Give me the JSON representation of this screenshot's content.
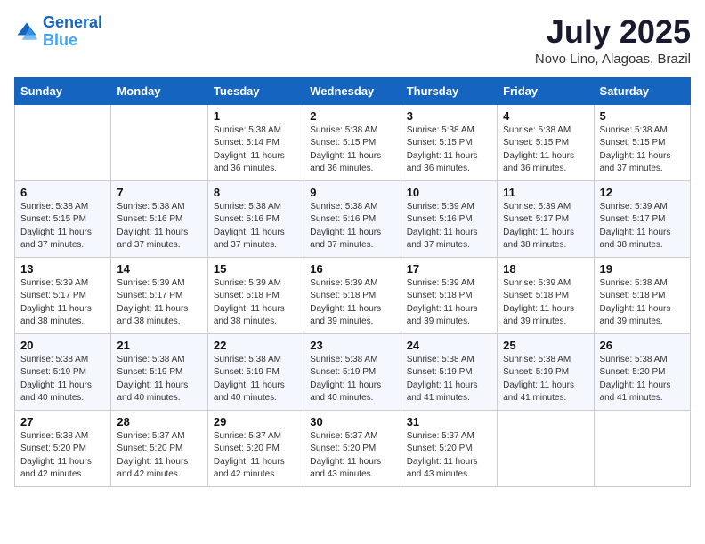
{
  "header": {
    "logo_line1": "General",
    "logo_line2": "Blue",
    "month_year": "July 2025",
    "location": "Novo Lino, Alagoas, Brazil"
  },
  "weekdays": [
    "Sunday",
    "Monday",
    "Tuesday",
    "Wednesday",
    "Thursday",
    "Friday",
    "Saturday"
  ],
  "weeks": [
    [
      {
        "day": "",
        "sunrise": "",
        "sunset": "",
        "daylight": ""
      },
      {
        "day": "",
        "sunrise": "",
        "sunset": "",
        "daylight": ""
      },
      {
        "day": "1",
        "sunrise": "Sunrise: 5:38 AM",
        "sunset": "Sunset: 5:14 PM",
        "daylight": "Daylight: 11 hours and 36 minutes."
      },
      {
        "day": "2",
        "sunrise": "Sunrise: 5:38 AM",
        "sunset": "Sunset: 5:15 PM",
        "daylight": "Daylight: 11 hours and 36 minutes."
      },
      {
        "day": "3",
        "sunrise": "Sunrise: 5:38 AM",
        "sunset": "Sunset: 5:15 PM",
        "daylight": "Daylight: 11 hours and 36 minutes."
      },
      {
        "day": "4",
        "sunrise": "Sunrise: 5:38 AM",
        "sunset": "Sunset: 5:15 PM",
        "daylight": "Daylight: 11 hours and 36 minutes."
      },
      {
        "day": "5",
        "sunrise": "Sunrise: 5:38 AM",
        "sunset": "Sunset: 5:15 PM",
        "daylight": "Daylight: 11 hours and 37 minutes."
      }
    ],
    [
      {
        "day": "6",
        "sunrise": "Sunrise: 5:38 AM",
        "sunset": "Sunset: 5:15 PM",
        "daylight": "Daylight: 11 hours and 37 minutes."
      },
      {
        "day": "7",
        "sunrise": "Sunrise: 5:38 AM",
        "sunset": "Sunset: 5:16 PM",
        "daylight": "Daylight: 11 hours and 37 minutes."
      },
      {
        "day": "8",
        "sunrise": "Sunrise: 5:38 AM",
        "sunset": "Sunset: 5:16 PM",
        "daylight": "Daylight: 11 hours and 37 minutes."
      },
      {
        "day": "9",
        "sunrise": "Sunrise: 5:38 AM",
        "sunset": "Sunset: 5:16 PM",
        "daylight": "Daylight: 11 hours and 37 minutes."
      },
      {
        "day": "10",
        "sunrise": "Sunrise: 5:39 AM",
        "sunset": "Sunset: 5:16 PM",
        "daylight": "Daylight: 11 hours and 37 minutes."
      },
      {
        "day": "11",
        "sunrise": "Sunrise: 5:39 AM",
        "sunset": "Sunset: 5:17 PM",
        "daylight": "Daylight: 11 hours and 38 minutes."
      },
      {
        "day": "12",
        "sunrise": "Sunrise: 5:39 AM",
        "sunset": "Sunset: 5:17 PM",
        "daylight": "Daylight: 11 hours and 38 minutes."
      }
    ],
    [
      {
        "day": "13",
        "sunrise": "Sunrise: 5:39 AM",
        "sunset": "Sunset: 5:17 PM",
        "daylight": "Daylight: 11 hours and 38 minutes."
      },
      {
        "day": "14",
        "sunrise": "Sunrise: 5:39 AM",
        "sunset": "Sunset: 5:17 PM",
        "daylight": "Daylight: 11 hours and 38 minutes."
      },
      {
        "day": "15",
        "sunrise": "Sunrise: 5:39 AM",
        "sunset": "Sunset: 5:18 PM",
        "daylight": "Daylight: 11 hours and 38 minutes."
      },
      {
        "day": "16",
        "sunrise": "Sunrise: 5:39 AM",
        "sunset": "Sunset: 5:18 PM",
        "daylight": "Daylight: 11 hours and 39 minutes."
      },
      {
        "day": "17",
        "sunrise": "Sunrise: 5:39 AM",
        "sunset": "Sunset: 5:18 PM",
        "daylight": "Daylight: 11 hours and 39 minutes."
      },
      {
        "day": "18",
        "sunrise": "Sunrise: 5:39 AM",
        "sunset": "Sunset: 5:18 PM",
        "daylight": "Daylight: 11 hours and 39 minutes."
      },
      {
        "day": "19",
        "sunrise": "Sunrise: 5:38 AM",
        "sunset": "Sunset: 5:18 PM",
        "daylight": "Daylight: 11 hours and 39 minutes."
      }
    ],
    [
      {
        "day": "20",
        "sunrise": "Sunrise: 5:38 AM",
        "sunset": "Sunset: 5:19 PM",
        "daylight": "Daylight: 11 hours and 40 minutes."
      },
      {
        "day": "21",
        "sunrise": "Sunrise: 5:38 AM",
        "sunset": "Sunset: 5:19 PM",
        "daylight": "Daylight: 11 hours and 40 minutes."
      },
      {
        "day": "22",
        "sunrise": "Sunrise: 5:38 AM",
        "sunset": "Sunset: 5:19 PM",
        "daylight": "Daylight: 11 hours and 40 minutes."
      },
      {
        "day": "23",
        "sunrise": "Sunrise: 5:38 AM",
        "sunset": "Sunset: 5:19 PM",
        "daylight": "Daylight: 11 hours and 40 minutes."
      },
      {
        "day": "24",
        "sunrise": "Sunrise: 5:38 AM",
        "sunset": "Sunset: 5:19 PM",
        "daylight": "Daylight: 11 hours and 41 minutes."
      },
      {
        "day": "25",
        "sunrise": "Sunrise: 5:38 AM",
        "sunset": "Sunset: 5:19 PM",
        "daylight": "Daylight: 11 hours and 41 minutes."
      },
      {
        "day": "26",
        "sunrise": "Sunrise: 5:38 AM",
        "sunset": "Sunset: 5:20 PM",
        "daylight": "Daylight: 11 hours and 41 minutes."
      }
    ],
    [
      {
        "day": "27",
        "sunrise": "Sunrise: 5:38 AM",
        "sunset": "Sunset: 5:20 PM",
        "daylight": "Daylight: 11 hours and 42 minutes."
      },
      {
        "day": "28",
        "sunrise": "Sunrise: 5:37 AM",
        "sunset": "Sunset: 5:20 PM",
        "daylight": "Daylight: 11 hours and 42 minutes."
      },
      {
        "day": "29",
        "sunrise": "Sunrise: 5:37 AM",
        "sunset": "Sunset: 5:20 PM",
        "daylight": "Daylight: 11 hours and 42 minutes."
      },
      {
        "day": "30",
        "sunrise": "Sunrise: 5:37 AM",
        "sunset": "Sunset: 5:20 PM",
        "daylight": "Daylight: 11 hours and 43 minutes."
      },
      {
        "day": "31",
        "sunrise": "Sunrise: 5:37 AM",
        "sunset": "Sunset: 5:20 PM",
        "daylight": "Daylight: 11 hours and 43 minutes."
      },
      {
        "day": "",
        "sunrise": "",
        "sunset": "",
        "daylight": ""
      },
      {
        "day": "",
        "sunrise": "",
        "sunset": "",
        "daylight": ""
      }
    ]
  ]
}
